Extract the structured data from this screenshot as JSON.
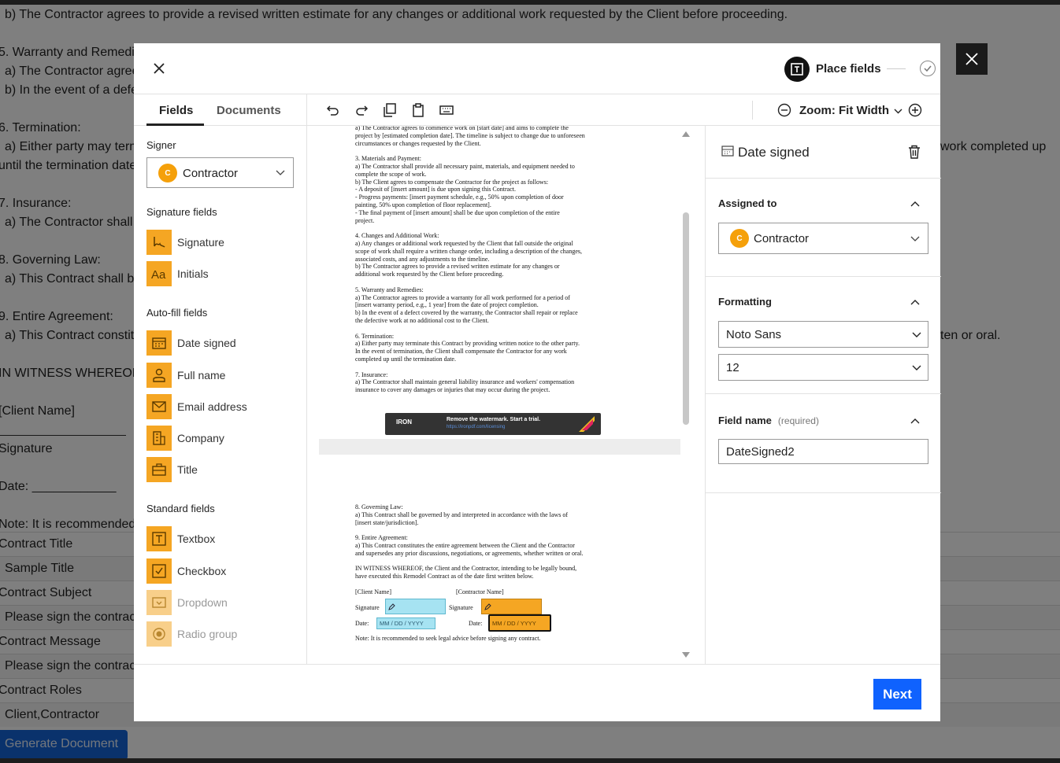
{
  "background": {
    "lines": [
      "b) The Contractor agrees to provide a revised written estimate for any changes or additional work requested by the Client before proceeding.",
      "5. Warranty and Remedie",
      "a) The Contractor agree",
      "b) In the event of a defe",
      "6. Termination:",
      "a) Either party may term",
      "until the termination date",
      "7. Insurance:",
      "a) The Contractor shall",
      "8. Governing Law:",
      "a) This Contract shall be",
      "9. Entire Agreement:",
      "a) This Contract constit",
      "IN WITNESS WHEREOF, t",
      "[Client Name]",
      "Signature",
      "Date: ____________",
      "Note: It is recommended",
      "work completed up",
      "ten or oral."
    ],
    "table_rows": [
      "Contract Title",
      "Sample Title",
      "Contract Subject",
      "Please sign the contrac",
      "Contract Message",
      "Please sign the contrac",
      "Contract Roles",
      "Client,Contractor"
    ],
    "generate_button": "Generate Document"
  },
  "header": {
    "step_label": "Place fields"
  },
  "tabs": {
    "fields": "Fields",
    "documents": "Documents"
  },
  "toolbar": {
    "zoom_label": "Zoom: Fit Width"
  },
  "left_panel": {
    "signer_heading": "Signer",
    "signer_value": "Contractor",
    "signer_initial": "C",
    "signature_heading": "Signature fields",
    "signature_fields": [
      "Signature",
      "Initials"
    ],
    "autofill_heading": "Auto-fill fields",
    "autofill_fields": [
      "Date signed",
      "Full name",
      "Email address",
      "Company",
      "Title"
    ],
    "standard_heading": "Standard fields",
    "standard_fields": [
      "Textbox",
      "Checkbox",
      "Dropdown",
      "Radio group"
    ]
  },
  "document": {
    "page1_lines": [
      "  a) The Contractor agrees to commence work on [start date] and aims to complete the",
      "project by [estimated completion date]. The timeline is subject to change due to unforeseen",
      "circumstances or changes requested by the Client.",
      "",
      "3. Materials and Payment:",
      "  a) The Contractor shall provide all necessary paint, materials, and equipment needed to",
      "complete the scope of work.",
      "  b) The Client agrees to compensate the Contractor for the project as follows:",
      "    - A deposit of [insert amount] is due upon signing this Contract.",
      "    - Progress payments: [insert payment schedule, e.g., 50% upon completion of door",
      "painting, 50% upon completion of floor replacement].",
      "    - The final payment of [insert amount] shall be due upon completion of the entire",
      "project.",
      "",
      "4. Changes and Additional Work:",
      "  a) Any changes or additional work requested by the Client that fall outside the original",
      "scope of work shall require a written change order, including a description of the changes,",
      "associated costs, and any adjustments to the timeline.",
      "  b) The Contractor agrees to provide a revised written estimate for any changes or",
      "additional work requested by the Client before proceeding.",
      "",
      "5. Warranty and Remedies:",
      "  a) The Contractor agrees to provide a warranty for all work performed for a period of",
      "[insert warranty period, e.g., 1 year] from the date of project completion.",
      "  b) In the event of a defect covered by the warranty, the Contractor shall repair or replace",
      "the defective work at no additional cost to the Client.",
      "",
      "6. Termination:",
      "  a) Either party may terminate this Contract by providing written notice to the other party.",
      "In the event of termination, the Client shall compensate the Contractor for any work",
      "completed up until the termination date.",
      "",
      "7. Insurance:",
      "  a) The Contractor shall maintain general liability insurance and workers' compensation",
      "insurance to cover any damages or injuries that may occur during the project."
    ],
    "watermark_brand": "IRON",
    "watermark_text": "Remove the watermark. Start a trial.",
    "watermark_url": "https://ironpdf.com/licensing",
    "page2_lines": [
      "8. Governing Law:",
      "  a) This Contract shall be governed by and interpreted in accordance with the laws of",
      "[insert state/jurisdiction].",
      "",
      "9. Entire Agreement:",
      "  a) This Contract constitutes the entire agreement between the Client and the Contractor",
      "and supersedes any prior discussions, negotiations, or agreements, whether written or oral.",
      "",
      "IN WITNESS WHEREOF, the Client and the Contractor, intending to be legally bound,",
      "have executed this Remodel Contract as of the date first written below."
    ],
    "client_name": "[Client Name]",
    "contractor_name": "[Contractor Name]",
    "signature_label": "Signature",
    "date_label": "Date:",
    "date_placeholder": "MM / DD / YYYY",
    "note": "Note: It is recommended to seek legal advice before signing any contract."
  },
  "right_panel": {
    "field_title": "Date signed",
    "assigned_heading": "Assigned to",
    "assigned_value": "Contractor",
    "assigned_initial": "C",
    "formatting_heading": "Formatting",
    "font_value": "Noto Sans",
    "size_value": "12",
    "field_name_heading": "Field name",
    "field_name_required": "(required)",
    "field_name_value": "DateSigned2"
  },
  "footer": {
    "next_label": "Next"
  },
  "colors": {
    "accent_orange": "#f5a623",
    "client_blue": "#a6e3f2",
    "primary_blue": "#0f62fe"
  }
}
